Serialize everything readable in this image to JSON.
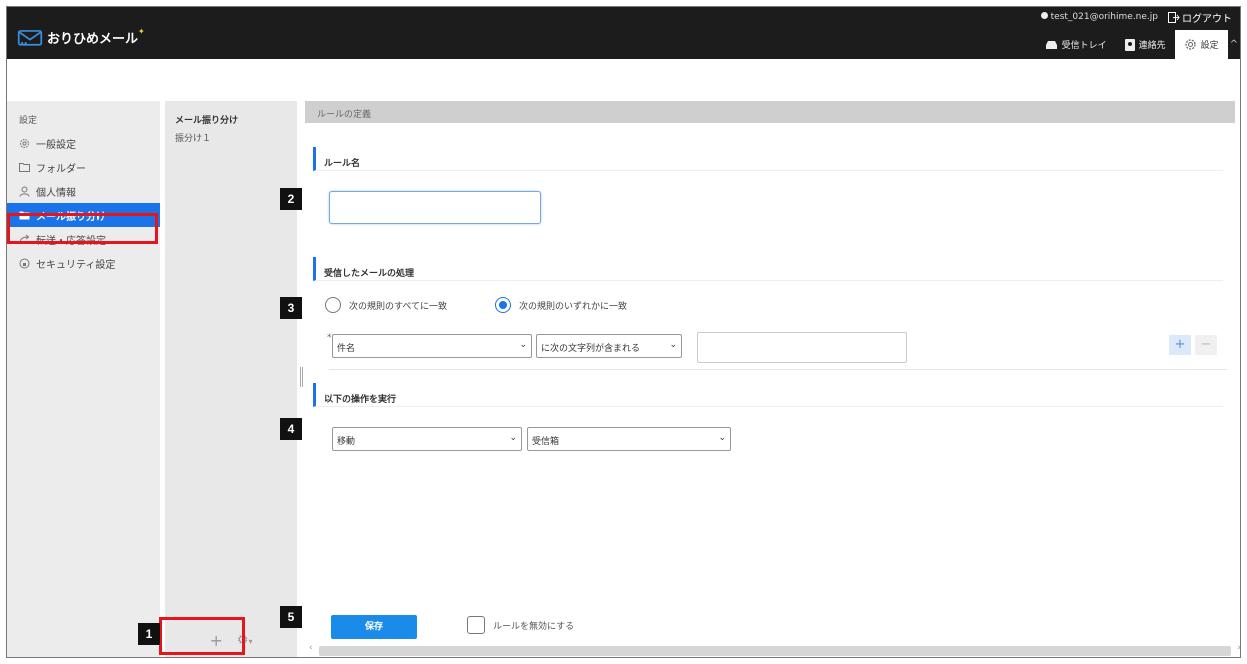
{
  "header": {
    "user_email": "test_021@orihime.ne.jp",
    "logout_label": "ログアウト",
    "app_name": "おりひめメール",
    "nav": [
      {
        "label": "受信トレイ",
        "icon": "inbox-icon"
      },
      {
        "label": "連絡先",
        "icon": "contacts-icon"
      },
      {
        "label": "設定",
        "icon": "gear-icon"
      }
    ]
  },
  "sidebar": {
    "heading": "設定",
    "items": [
      {
        "label": "一般設定",
        "icon": "gear-icon"
      },
      {
        "label": "フォルダー",
        "icon": "folder-icon"
      },
      {
        "label": "個人情報",
        "icon": "person-icon"
      },
      {
        "label": "メール振り分け",
        "icon": "folder-filled-icon",
        "active": true
      },
      {
        "label": "転送・応答設定",
        "icon": "forward-icon"
      },
      {
        "label": "セキュリティ設定",
        "icon": "security-icon"
      }
    ]
  },
  "rule_list": {
    "heading": "メール振り分け",
    "items": [
      "振分け１"
    ]
  },
  "main": {
    "header": "ルールの定義",
    "section_rule_name": "ルール名",
    "rule_name_value": "",
    "section_received": "受信したメールの処理",
    "radio_all": "次の規則のすべてに一致",
    "radio_any": "次の規則のいずれかに一致",
    "selected_radio": "any",
    "condition": {
      "required_mark": "*",
      "field": "件名",
      "operator": "に次の文字列が含まれる",
      "value": "",
      "add_label": "+",
      "remove_label": "−"
    },
    "section_action": "以下の操作を実行",
    "action": {
      "type": "移動",
      "target": "受信箱"
    },
    "save_label": "保存",
    "disable_label": "ルールを無効にする",
    "disable_checked": false
  },
  "callouts": [
    "1",
    "2",
    "3",
    "4",
    "5"
  ],
  "colors": {
    "accent": "#1a73e8",
    "highlight": "#e8141b",
    "topbar": "#1c1c1c"
  }
}
